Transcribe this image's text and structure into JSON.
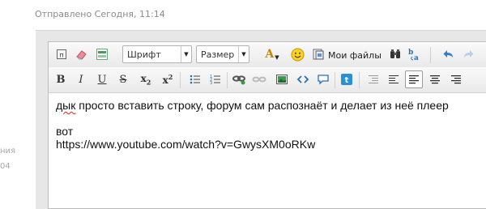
{
  "post": {
    "sent_label": "Отправлено Сегодня, 11:14"
  },
  "sidebar_fragments": [
    "ния",
    "04"
  ],
  "toolbar": {
    "font_select": "Шрифт",
    "size_select": "Размер",
    "my_files": "Мои файлы",
    "icons_row1": [
      "plain-text-icon",
      "eraser-icon",
      "toggle-source-icon",
      "text-color-icon",
      "smiley-icon",
      "my-files-icon",
      "binoculars-icon",
      "translate-icon",
      "undo-icon",
      "redo-icon"
    ],
    "icons_row2": [
      "bold-icon",
      "italic-icon",
      "underline-icon",
      "strikethrough-icon",
      "subscript-icon",
      "superscript-icon",
      "bullet-list-icon",
      "numbered-list-icon",
      "link-icon",
      "unlink-icon",
      "image-icon",
      "code-icon",
      "quote-icon",
      "twitter-icon",
      "outdent-icon",
      "indent-icon",
      "align-left-icon",
      "align-center-icon",
      "align-right-icon"
    ],
    "labels": {
      "bold": "B",
      "italic": "I",
      "underline": "U",
      "strike": "S",
      "subscript": "x",
      "subscript_mark": "2",
      "superscript": "x",
      "superscript_mark": "2",
      "text_color": "A"
    }
  },
  "editor": {
    "line1_misspelled": "дык",
    "line1_rest": " просто вставить строку, форум сам распознаёт и делает из неё плеер",
    "line2": "вот",
    "line3": "https://www.youtube.com/watch?v=GwysXM0oRKw"
  }
}
